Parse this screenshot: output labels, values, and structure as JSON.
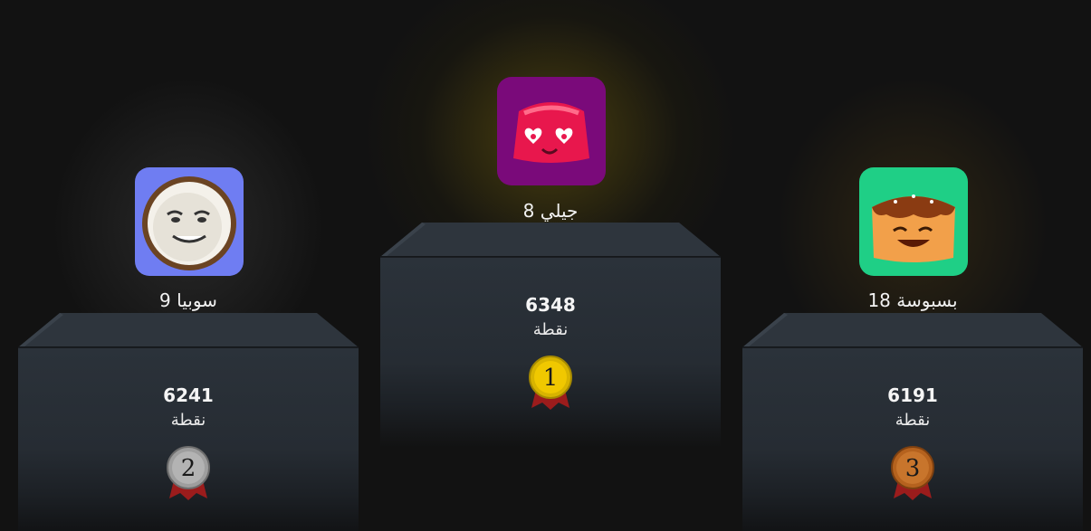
{
  "points_label": "نقطة",
  "podium": [
    {
      "rank": 1,
      "medal_number": "1",
      "name": "جيلي 8",
      "score": "6348",
      "avatar_icon": "jelly-icon",
      "avatar_bg": "#7a0a7a",
      "medal_color": "#d8b400"
    },
    {
      "rank": 2,
      "medal_number": "2",
      "name": "سوبيا 9",
      "score": "6241",
      "avatar_icon": "coconut-icon",
      "avatar_bg": "#6f7df2",
      "medal_color": "#9e9e9e"
    },
    {
      "rank": 3,
      "medal_number": "3",
      "name": "بسبوسة 18",
      "score": "6191",
      "avatar_icon": "basbousa-icon",
      "avatar_bg": "#1fcf86",
      "medal_color": "#b5621e"
    }
  ]
}
